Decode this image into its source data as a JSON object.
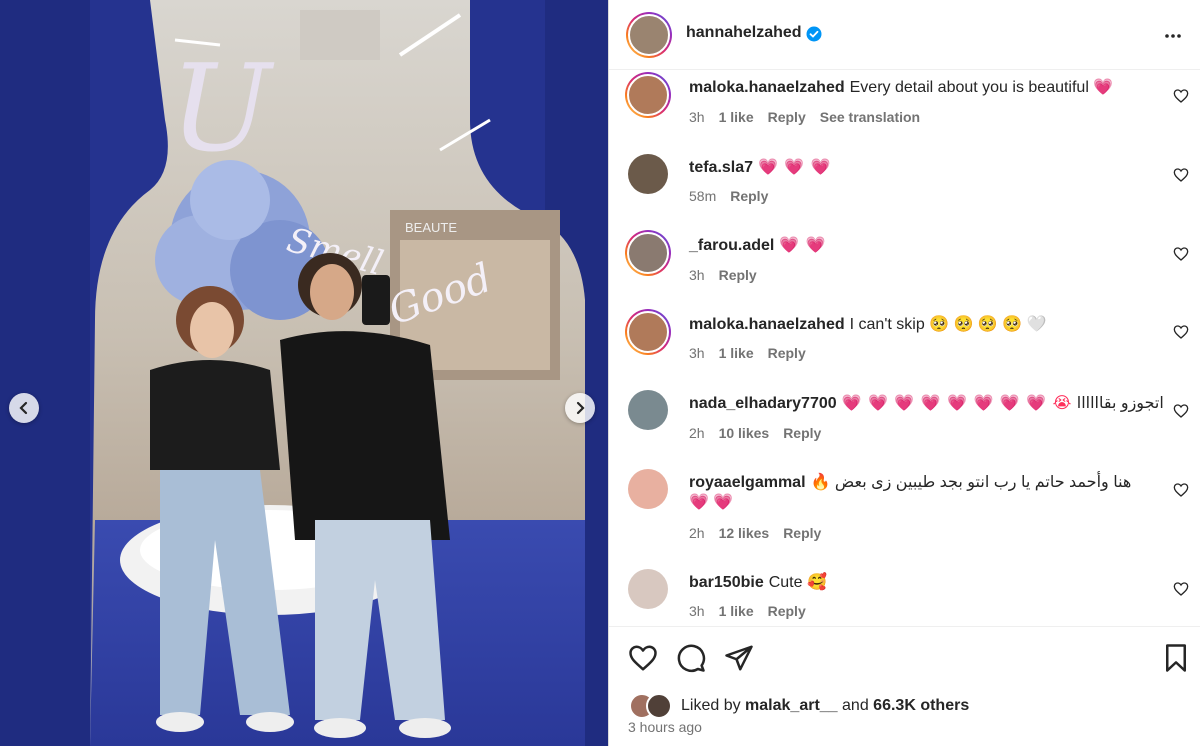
{
  "post": {
    "author": "hannahelzahed",
    "time_ago": "3 hours ago",
    "liked_by_user": "malak_art__",
    "liked_by_prefix": "Liked by",
    "liked_by_and": "and",
    "liked_by_others": "66.3K others"
  },
  "media": {
    "sign_letter": "U",
    "sign_word1": "Smell",
    "sign_word2": "Good",
    "store_sign": "BEAUTE"
  },
  "comments": [
    {
      "user": "maloka.hanaelzahed",
      "text": "Every detail about you is beautiful",
      "emoji": "💗",
      "time": "3h",
      "likes": "1 like",
      "reply": "Reply",
      "extra": "See translation",
      "avatar_color": "#b07a5a",
      "ring": true
    },
    {
      "user": "tefa.sla7",
      "text": "",
      "emoji": "💗 💗 💗",
      "time": "58m",
      "likes": "",
      "reply": "Reply",
      "extra": "",
      "avatar_color": "#6b5a4a",
      "ring": false
    },
    {
      "user": "_farou.adel",
      "text": "",
      "emoji": "💗 💗",
      "time": "3h",
      "likes": "",
      "reply": "Reply",
      "extra": "",
      "avatar_color": "#8a7a70",
      "ring": true
    },
    {
      "user": "maloka.hanaelzahed",
      "text": "I can't skip",
      "emoji": "🥺 🥺 🥺 🥺 🤍",
      "time": "3h",
      "likes": "1 like",
      "reply": "Reply",
      "extra": "",
      "avatar_color": "#b07a5a",
      "ring": true
    },
    {
      "user": "nada_elhadary7700",
      "text": "اتجوزو بقاااااا",
      "emoji": "💗 💗 💗 💗 💗 💗 💗 💗 😭",
      "time": "2h",
      "likes": "10 likes",
      "reply": "Reply",
      "extra": "",
      "avatar_color": "#7a8a90",
      "ring": false
    },
    {
      "user": "royaaelgammal",
      "text": "هنا وأحمد حاتم يا رب انتو بجد طيبين زى بعض",
      "emoji": "🔥",
      "emoji2": "💗 💗",
      "time": "2h",
      "likes": "12 likes",
      "reply": "Reply",
      "extra": "",
      "avatar_color": "#e8b0a0",
      "ring": false
    },
    {
      "user": "bar150bie",
      "text": "Cute",
      "emoji": "🥰",
      "time": "3h",
      "likes": "1 like",
      "reply": "Reply",
      "extra": "",
      "avatar_color": "#d8c8c0",
      "ring": false
    }
  ],
  "colors": {
    "accent_heart": "#ff2f5b",
    "verified_blue": "#0095f6",
    "muted_text": "#737373",
    "media_blue": "#22318a"
  },
  "icons": {
    "like": "heart-outline-icon",
    "comment": "comment-bubble-icon",
    "share": "paper-plane-icon",
    "save": "bookmark-icon",
    "more": "more-horizontal-icon",
    "verified": "verified-badge-icon",
    "prev": "chevron-left-icon",
    "next": "chevron-right-icon"
  }
}
